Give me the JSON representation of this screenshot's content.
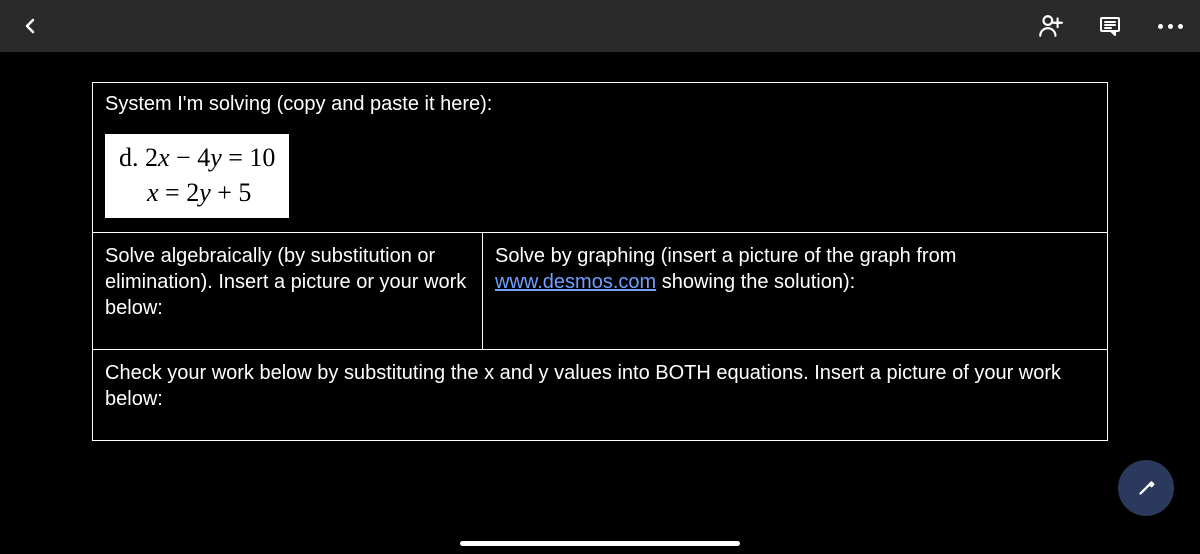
{
  "header": {
    "icons": {
      "back": "back-icon",
      "addPerson": "person-add-icon",
      "comments": "comments-icon",
      "more": "more-icon"
    }
  },
  "main": {
    "row1": {
      "title": "System I'm solving (copy and paste it here):",
      "equation": {
        "line1_prefix": "d. 2",
        "line1_x": "x",
        "line1_mid": " − 4",
        "line1_y": "y",
        "line1_suffix": " = 10",
        "line2_x": "x",
        "line2_mid": " = 2",
        "line2_y": "y",
        "line2_suffix": " + 5"
      }
    },
    "row2": {
      "left": "Solve algebraically (by substitution or elimination). Insert a picture or your work below:",
      "right_before": "Solve by graphing (insert a picture of the graph from ",
      "right_link": "www.desmos.com",
      "right_after": " showing the solution):"
    },
    "row3": "Check your work below by substituting the x and y values into BOTH equations. Insert a picture of your work below:"
  },
  "fab": {
    "icon": "edit-icon"
  }
}
